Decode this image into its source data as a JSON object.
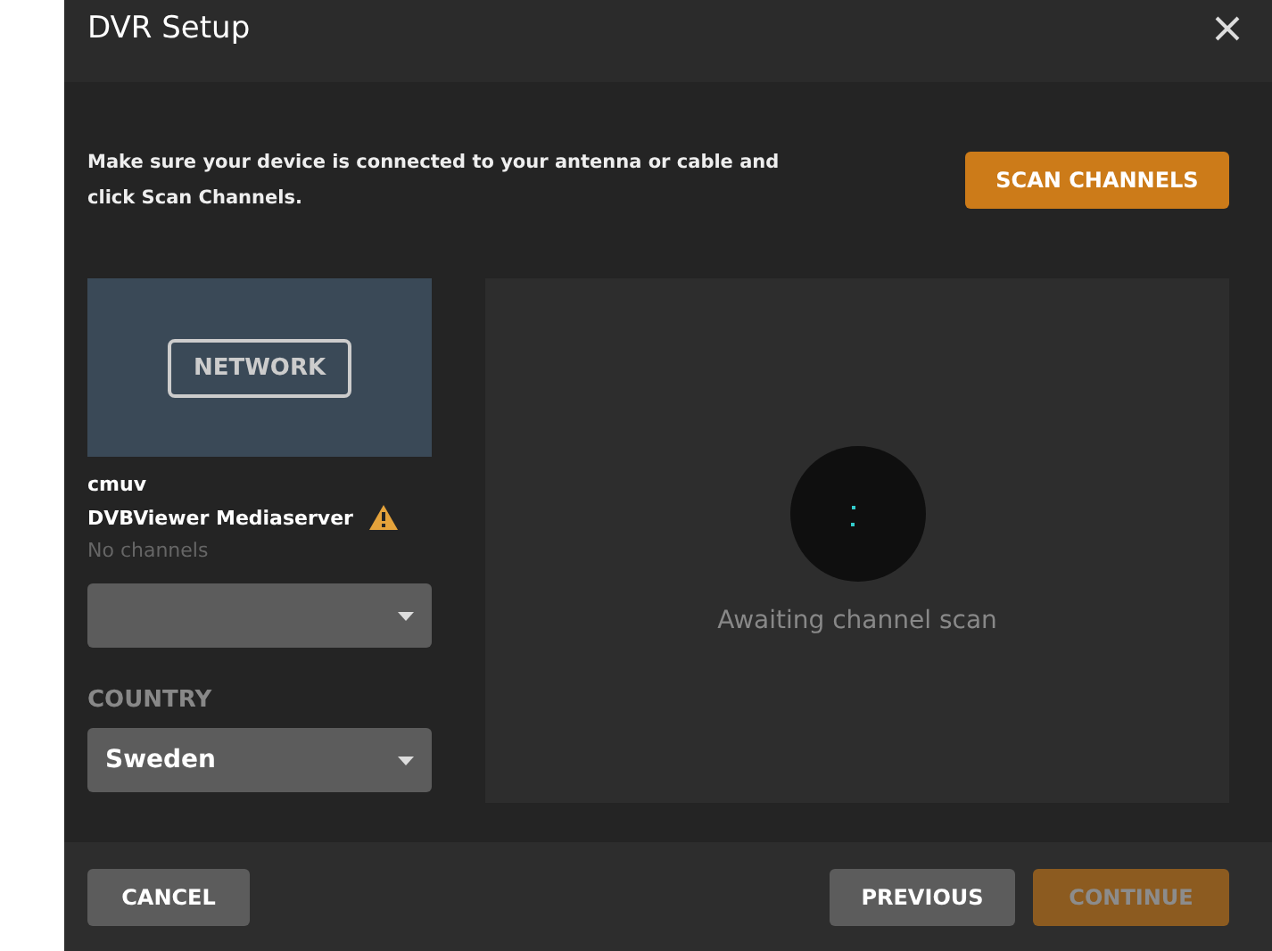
{
  "window": {
    "title": "DVR Setup"
  },
  "intro": "Make sure your device is connected to your antenna or cable and click Scan Channels.",
  "scan_button": "SCAN CHANNELS",
  "device": {
    "thumbnail_label": "NETWORK",
    "name": "cmuv",
    "model": "DVBViewer Mediaserver",
    "warning": true,
    "status": "No channels"
  },
  "country": {
    "label": "COUNTRY",
    "value": "Sweden"
  },
  "scan_status": "Awaiting channel scan",
  "buttons": [
    {
      "label": "CANCEL",
      "kind": "secondary",
      "disabled": false
    },
    {
      "label": "PREVIOUS",
      "kind": "secondary",
      "disabled": false
    },
    {
      "label": "CONTINUE",
      "kind": "primary",
      "disabled": true
    }
  ]
}
